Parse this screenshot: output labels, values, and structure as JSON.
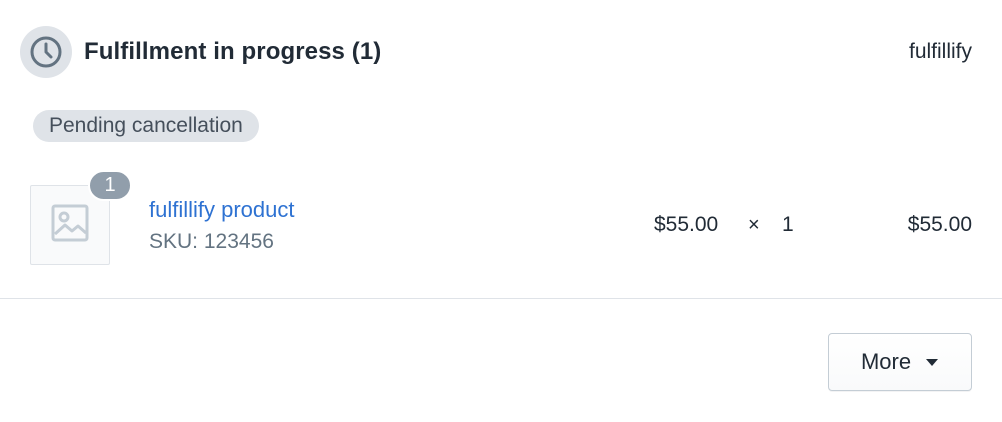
{
  "fulfillment": {
    "title": "Fulfillment in progress (1)",
    "location": "fulfillify",
    "status_badge": "Pending cancellation",
    "icon": "clock-icon"
  },
  "line_item": {
    "quantity_badge": "1",
    "product_name": "fulfillify product",
    "sku_label": "SKU:",
    "sku_value": "123456",
    "unit_price": "$55.00",
    "times": "×",
    "quantity": "1",
    "total": "$55.00",
    "image_icon": "image-placeholder-icon"
  },
  "actions": {
    "more_label": "More",
    "more_icon": "caret-down-icon"
  },
  "colors": {
    "link": "#2e72d2",
    "badge_bg": "#dfe3e8",
    "qty_badge_bg": "#919eab",
    "text": "#212b36",
    "subdued": "#637381"
  }
}
